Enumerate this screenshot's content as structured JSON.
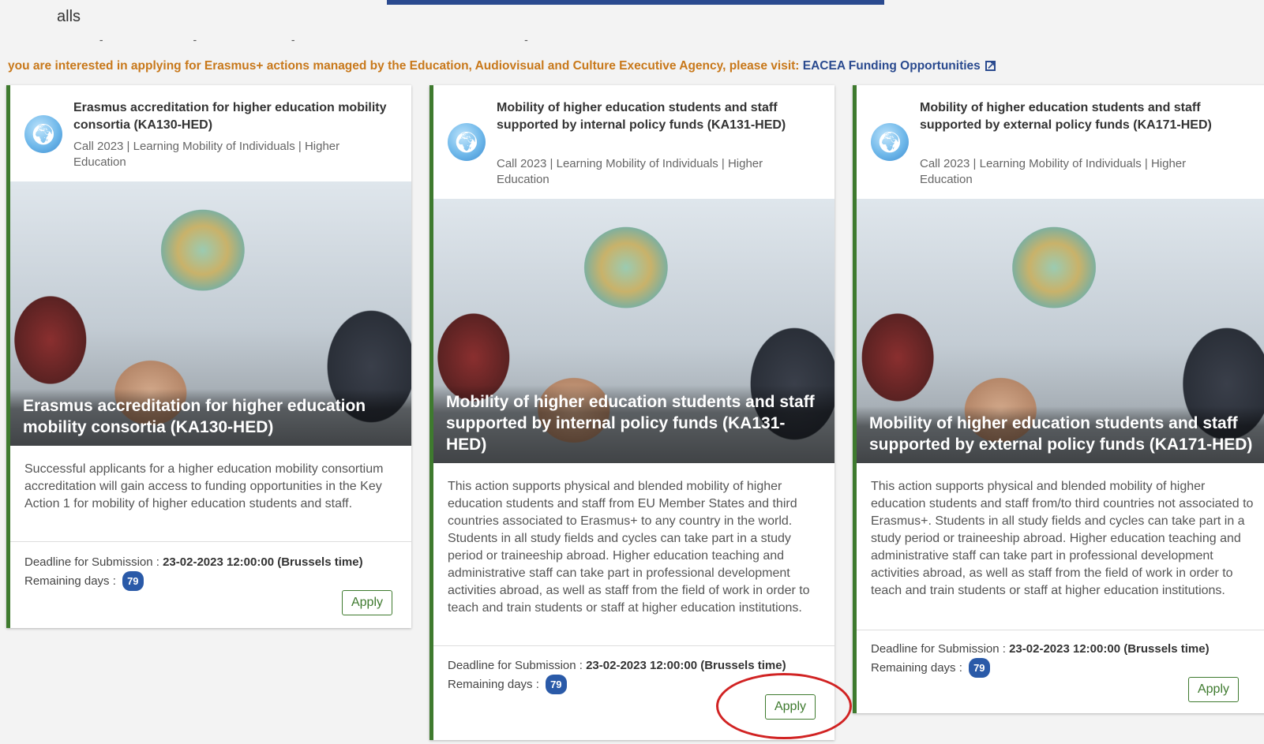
{
  "header": {
    "title": "alls",
    "notice_text": "you are interested in applying for Erasmus+ actions managed by the Education, Audiovisual and Culture Executive Agency, please visit: ",
    "notice_link": "EACEA Funding Opportunities"
  },
  "cards": [
    {
      "title": "Erasmus accreditation for higher education mobility consortia (KA130-HED)",
      "subtitle": "Call 2023 | Learning Mobility of Individuals | Higher Education",
      "hero_caption": "Erasmus accreditation for higher education mobility consortia (KA130-HED)",
      "description": "Successful applicants for a higher education mobility consortium accreditation will gain access to funding opportunities in the Key Action 1 for mobility of higher education students and staff.",
      "deadline_label": "Deadline for Submission : ",
      "deadline_value": "23-02-2023 12:00:00 (Brussels time)",
      "remaining_label": "Remaining days : ",
      "remaining_days": "79",
      "apply_label": "Apply"
    },
    {
      "title": "Mobility of higher education students and staff supported by internal policy funds (KA131-HED)",
      "subtitle": "Call 2023 | Learning Mobility of Individuals | Higher Education",
      "hero_caption": "Mobility of higher education students and staff supported by internal policy funds (KA131-HED)",
      "description": "This action supports physical and blended mobility of higher education students and staff from EU Member States and third countries associated to Erasmus+ to any country in the world. Students in all study fields and cycles can take part in a study period or traineeship abroad. Higher education teaching and administrative staff can take part in professional development activities abroad, as well as staff from the field of work in order to teach and train students or staff at higher education institutions.",
      "deadline_label": "Deadline for Submission : ",
      "deadline_value": "23-02-2023 12:00:00 (Brussels time)",
      "remaining_label": "Remaining days : ",
      "remaining_days": "79",
      "apply_label": "Apply"
    },
    {
      "title": "Mobility of higher education students and staff supported by external policy funds (KA171-HED)",
      "subtitle": "Call 2023 | Learning Mobility of Individuals | Higher Education",
      "hero_caption": "Mobility of higher education students and staff supported by external policy funds (KA171-HED)",
      "description": "This action supports physical and blended mobility of higher education students and staff from/to third countries not associated to Erasmus+. Students in all study fields and cycles can take part in a study period or traineeship abroad. Higher education teaching and administrative staff can take part in professional development activities abroad, as well as staff from the field of work in order to teach and train students or staff at higher education institutions.",
      "deadline_label": "Deadline for Submission : ",
      "deadline_value": "23-02-2023 12:00:00 (Brussels time)",
      "remaining_label": "Remaining days : ",
      "remaining_days": "79",
      "apply_label": "Apply"
    }
  ],
  "colors": {
    "accent_green": "#3e7a2e",
    "notice_orange": "#c8781a",
    "link_blue": "#2a4a8f",
    "highlight_red": "#d12323"
  },
  "icons": [
    "globe-logo-icon",
    "external-link-icon"
  ]
}
